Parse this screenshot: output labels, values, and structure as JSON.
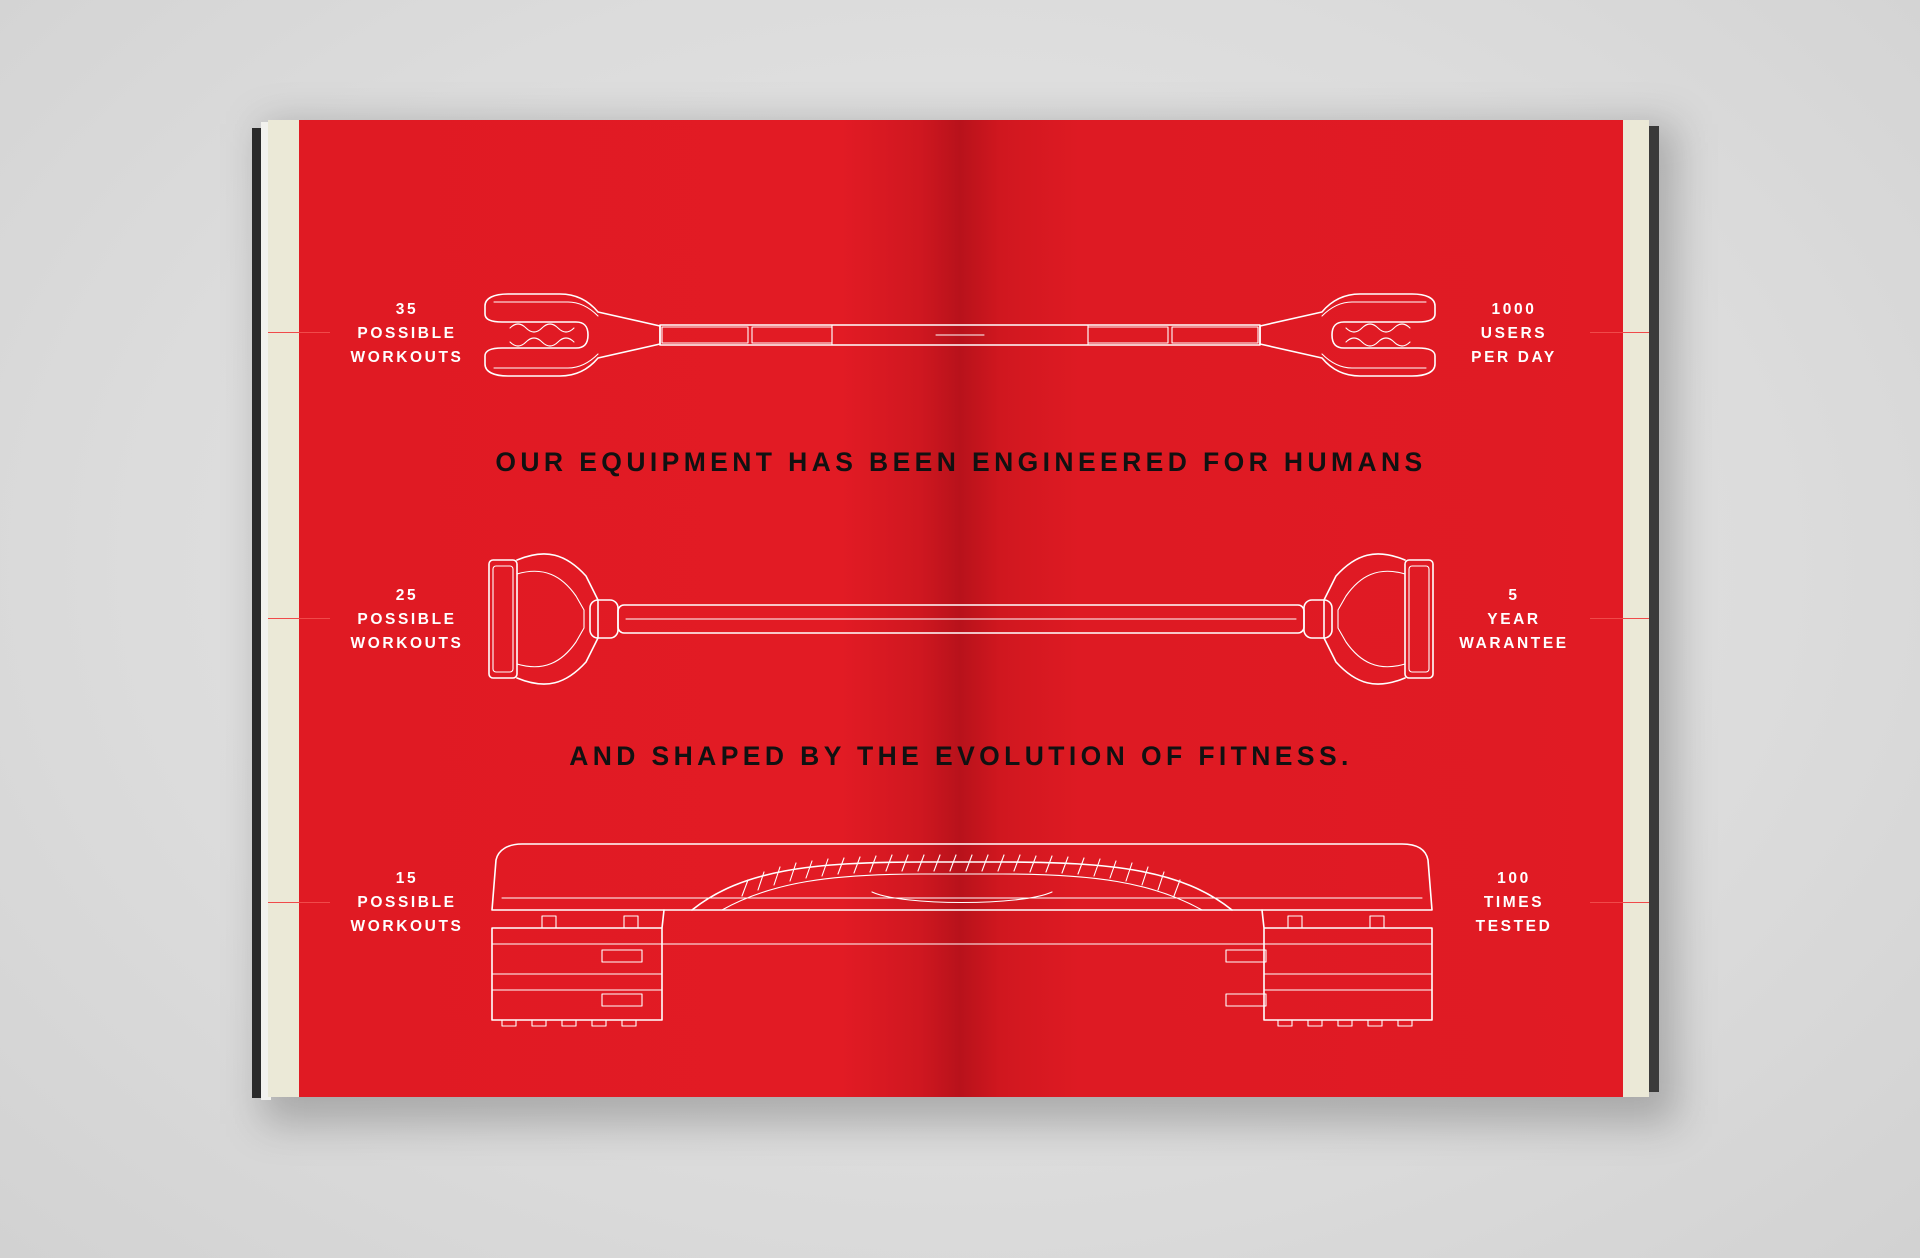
{
  "colors": {
    "page_red": "#e11b24",
    "background": "#dcdcdc",
    "paper_edge": "#ebe9d7",
    "headline_text": "#111111",
    "stat_text": "#ffffff"
  },
  "headlines": {
    "top": "OUR EQUIPMENT HAS BEEN ENGINEERED FOR HUMANS",
    "bottom": "AND SHAPED BY THE EVOLUTION OF FITNESS."
  },
  "stats": {
    "row1_left": {
      "number": "35",
      "line1": "POSSIBLE",
      "line2": "WORKOUTS"
    },
    "row1_right": {
      "number": "1000",
      "line1": "USERS",
      "line2": "PER DAY"
    },
    "row2_left": {
      "number": "25",
      "line1": "POSSIBLE",
      "line2": "WORKOUTS"
    },
    "row2_right": {
      "number": "5",
      "line1": "YEAR",
      "line2": "WARANTEE"
    },
    "row3_left": {
      "number": "15",
      "line1": "POSSIBLE",
      "line2": "WORKOUTS"
    },
    "row3_right": {
      "number": "100",
      "line1": "TIMES",
      "line2": "TESTED"
    }
  },
  "illustrations": [
    "weighted-bar-drawing",
    "resistance-bar-drawing",
    "step-platform-drawing"
  ]
}
